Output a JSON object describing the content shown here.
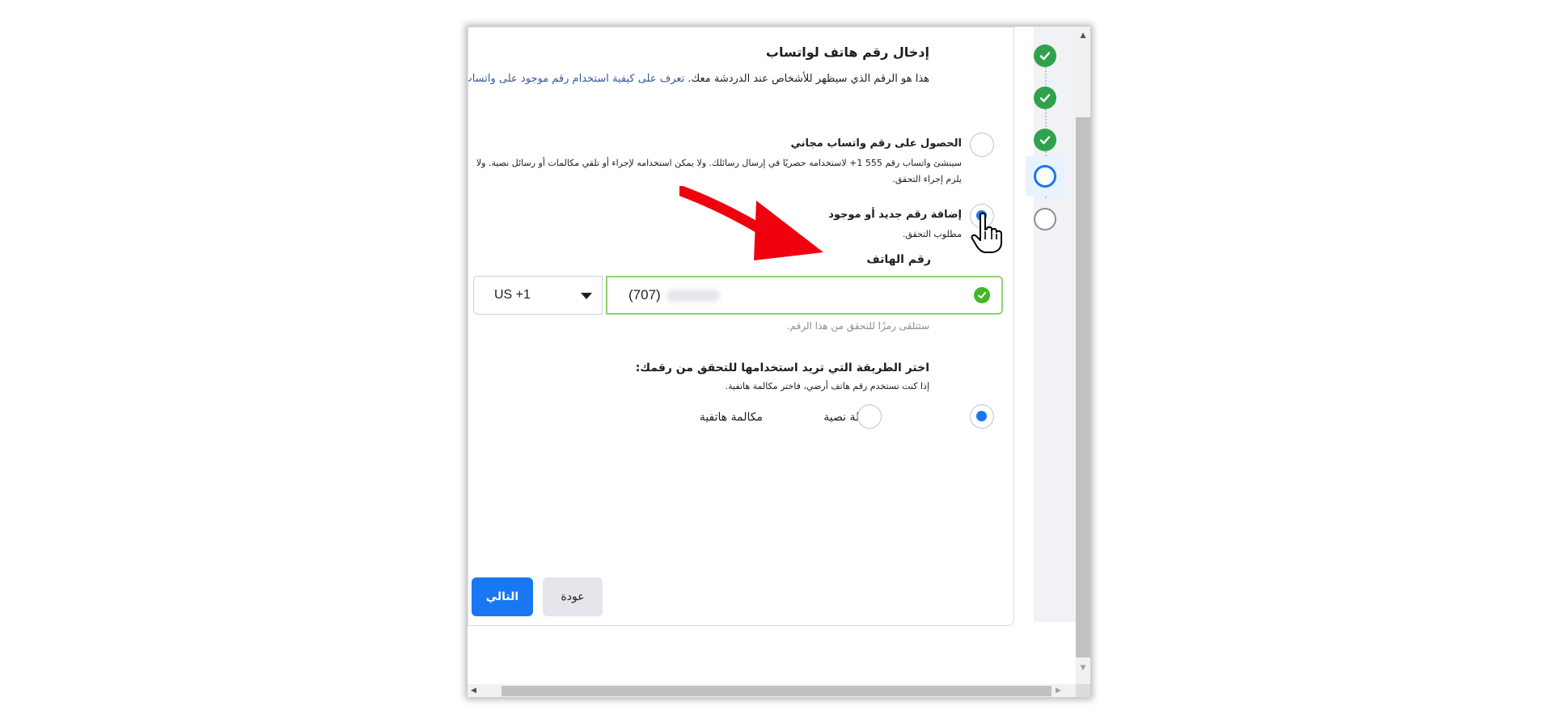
{
  "dialog": {
    "title": "إدخال رقم هاتف لواتساب",
    "description_text": "هذا هو الرقم الذي سيظهر للأشخاص عند الدردشة معك. ",
    "description_link": "تعرف على كيفية استخدام رقم موجود على واتساب بالفعل.",
    "options": [
      {
        "title": "الحصول على رقم واتساب مجاني",
        "description": "سينشئ واتساب رقم 555 1+ لاستخدامه حصريًا في إرسال رسائلك. ولا يمكن استخدامه لإجراء أو تلقي مكالمات أو رسائل نصية. ولا يلزم إجراء التحقق.",
        "selected": false
      },
      {
        "title": "إضافة رقم جديد أو موجود",
        "description": "مطلوب التحقق.",
        "selected": true
      }
    ],
    "phone_label": "رقم الهاتف",
    "country_code": "US +1",
    "phone_value": "(707)",
    "phone_hint": "ستتلقى رمزًا للتحقق من هذا الرقم.",
    "method_title": "اختر الطريقة التي تريد استخدامها للتحقق من رقمك:",
    "method_hint": "إذا كنت تستخدم رقم هاتف أرضي، فاختر مكالمة هاتفية.",
    "methods": [
      {
        "label": "رسالة نصية",
        "selected": true
      },
      {
        "label": "مكالمة هاتفية",
        "selected": false
      }
    ],
    "next_button": "التالي",
    "back_button": "عودة"
  },
  "stepper": {
    "steps": [
      "done",
      "done",
      "done",
      "current",
      "pending"
    ]
  },
  "colors": {
    "primary": "#1877f2",
    "success": "#31a24c",
    "annotation_arrow": "#f0000f"
  },
  "icons": [
    "check-icon",
    "caret-down-icon",
    "red-arrow-annotation",
    "hand-pointer-cursor"
  ]
}
